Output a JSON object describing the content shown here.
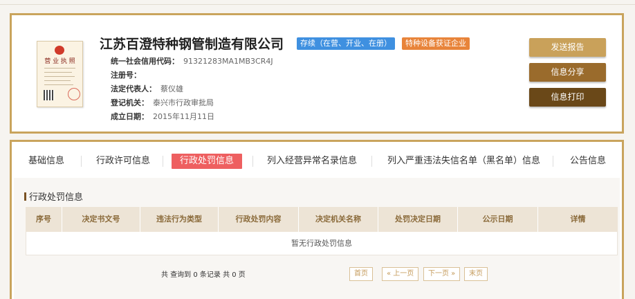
{
  "company": {
    "name": "江苏百澄特种钢管制造有限公司",
    "status_badge": "存续（在营、开业、在册）",
    "special_badge": "特种设备获证企业",
    "license_title": "营 业 执 照",
    "fields": [
      {
        "label": "统一社会信用代码：",
        "value": "91321283MA1MB3CR4J"
      },
      {
        "label": "注册号：",
        "value": ""
      },
      {
        "label": "法定代表人：",
        "value": "蔡仪雄"
      },
      {
        "label": "登记机关：",
        "value": "泰兴市行政审批局"
      },
      {
        "label": "成立日期：",
        "value": "2015年11月11日"
      }
    ]
  },
  "actions": {
    "send_report": "发送报告",
    "share": "信息分享",
    "print": "信息打印"
  },
  "tabs": [
    {
      "label": "基础信息",
      "active": false
    },
    {
      "label": "行政许可信息",
      "active": false
    },
    {
      "label": "行政处罚信息",
      "active": true
    },
    {
      "label": "列入经营异常名录信息",
      "active": false
    },
    {
      "label": "列入严重违法失信名单（黑名单）信息",
      "active": false
    },
    {
      "label": "公告信息",
      "active": false
    }
  ],
  "penalty": {
    "title": "行政处罚信息",
    "columns": [
      "序号",
      "决定书文号",
      "违法行为类型",
      "行政处罚内容",
      "决定机关名称",
      "处罚决定日期",
      "公示日期",
      "详情"
    ],
    "empty_text": "暂无行政处罚信息"
  },
  "pagination": {
    "summary": "共 查询到 0 条记录 共 0 页",
    "first": "首页",
    "prev": "« 上一页",
    "next": "下一页 »",
    "last": "末页"
  },
  "colors": {
    "accent_border": "#c9a45c",
    "active_tab": "#ee5f60",
    "status_badge": "#3f90e0",
    "special_badge": "#e8843a"
  }
}
